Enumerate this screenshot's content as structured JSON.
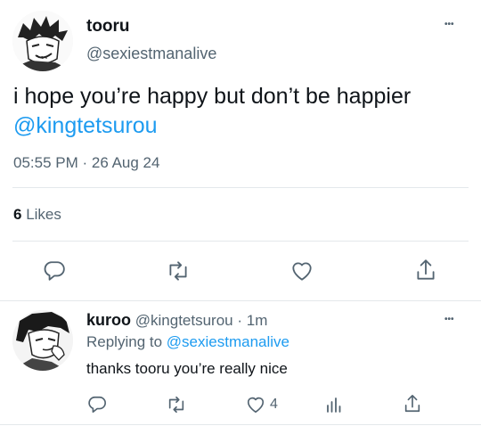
{
  "tweet": {
    "display_name": "tooru",
    "handle": "@sexiestmanalive",
    "text": "i hope you’re happy but don’t be happier",
    "mention": "@kingtetsurou",
    "timestamp": "05:55 PM · 26 Aug 24",
    "likes_count": "6",
    "likes_label": "Likes",
    "more_label": "•••"
  },
  "reply": {
    "display_name": "kuroo",
    "handle": "@kingtetsurou",
    "age": "· 1m",
    "replying_label": "Replying to",
    "replying_to": "@sexiestmanalive",
    "text": "thanks tooru you’re really nice",
    "like_count": "4",
    "more_label": "•••"
  },
  "colors": {
    "accent": "#1d9bf0",
    "secondary_text": "#536471",
    "divider": "#e4e8eb"
  },
  "icons": {
    "tweet_actions": [
      "reply-icon",
      "retweet-icon",
      "like-icon",
      "share-icon"
    ],
    "reply_actions": [
      "reply-icon",
      "retweet-icon",
      "like-icon",
      "analytics-icon",
      "share-icon"
    ]
  }
}
